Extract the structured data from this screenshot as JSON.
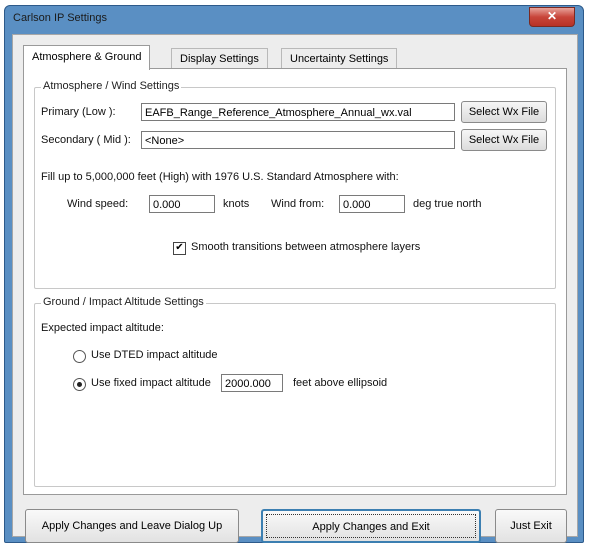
{
  "window": {
    "title": "Carlson IP Settings",
    "close_glyph": "✕"
  },
  "tabs": [
    {
      "label": "Atmosphere & Ground"
    },
    {
      "label": "Display Settings"
    },
    {
      "label": "Uncertainty Settings"
    }
  ],
  "atmosphere": {
    "group_label": "Atmosphere / Wind Settings",
    "primary_label": "Primary   (Low ):",
    "primary_value": "EAFB_Range_Reference_Atmosphere_Annual_wx.val",
    "secondary_label": "Secondary ( Mid ):",
    "secondary_value": "<None>",
    "select_button": "Select Wx File",
    "fill_text": "Fill up to 5,000,000 feet (High) with 1976 U.S. Standard Atmosphere with:",
    "wind_speed_label": "Wind speed:",
    "wind_speed_value": "0.000",
    "wind_speed_unit": "knots",
    "wind_from_label": "Wind from:",
    "wind_from_value": "0.000",
    "wind_from_unit": "deg true north",
    "smooth_label": "Smooth transitions between atmosphere layers",
    "smooth_checked": true
  },
  "ground": {
    "group_label": "Ground / Impact Altitude Settings",
    "expected_label": "Expected impact altitude:",
    "option_dted": "Use DTED impact altitude",
    "option_fixed": "Use fixed impact altitude",
    "fixed_value": "2000.000",
    "fixed_unit": "feet above ellipsoid",
    "selected": "fixed"
  },
  "buttons": {
    "apply_leave": "Apply Changes and Leave Dialog Up",
    "apply_exit": "Apply Changes and Exit",
    "just_exit": "Just Exit"
  }
}
